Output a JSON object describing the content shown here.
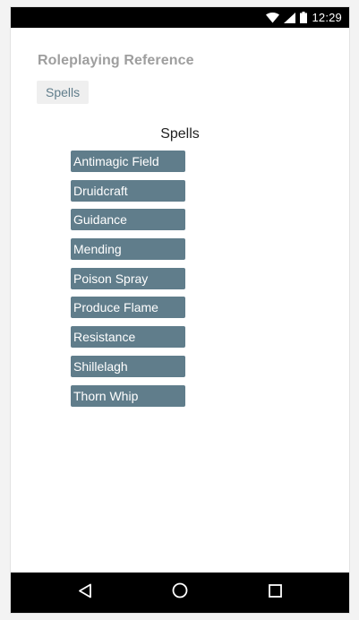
{
  "status_bar": {
    "time": "12:29",
    "icons": [
      "wifi-icon",
      "signal-icon",
      "battery-icon"
    ]
  },
  "app": {
    "title": "Roleplaying Reference"
  },
  "breadcrumb": {
    "items": [
      "Spells"
    ]
  },
  "section": {
    "title": "Spells"
  },
  "spells": [
    "Antimagic Field",
    "Druidcraft",
    "Guidance",
    "Mending",
    "Poison Spray",
    "Produce Flame",
    "Resistance",
    "Shillelagh",
    "Thorn Whip"
  ],
  "nav_bar": {
    "buttons": [
      "back-icon",
      "home-icon",
      "recents-icon"
    ]
  },
  "colors": {
    "accent": "#607d8b",
    "title_gray": "#9e9e9e",
    "crumb_bg": "#efefef",
    "system_bar": "#000000"
  }
}
